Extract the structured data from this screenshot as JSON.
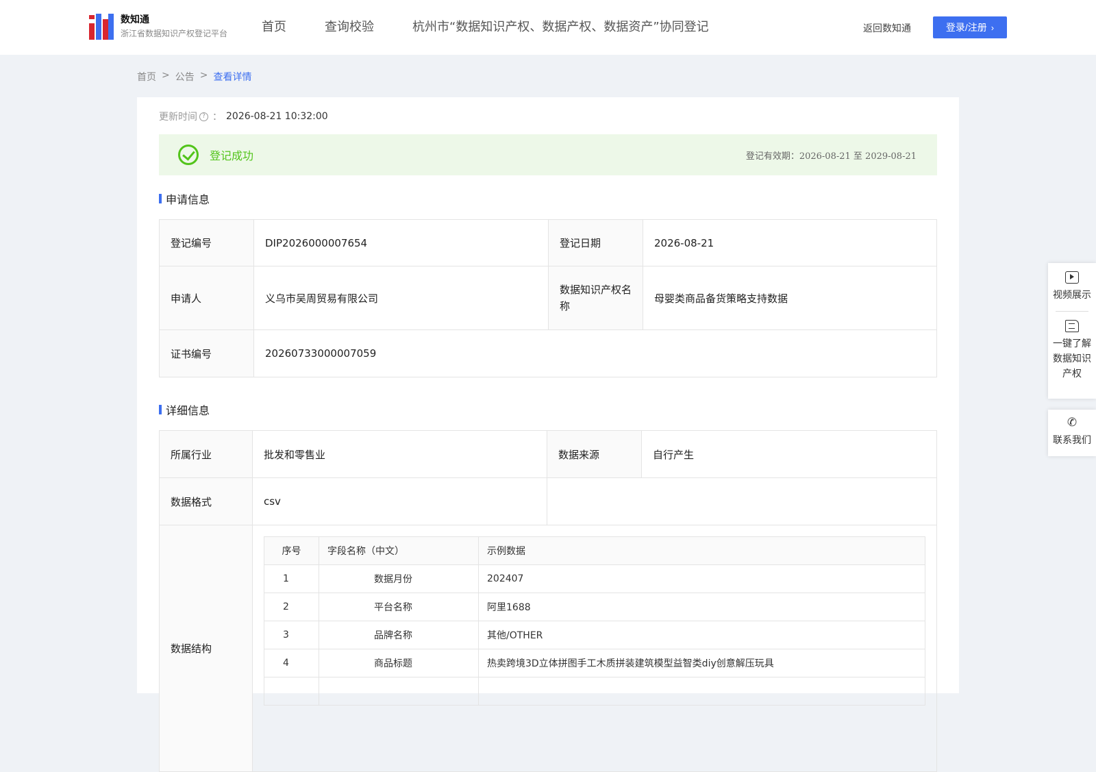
{
  "header": {
    "logo_title": "数知通",
    "logo_subtitle": "浙江省数据知识产权登记平台",
    "nav": [
      "首页",
      "查询校验",
      "杭州市“数据知识产权、数据产权、数据资产”协同登记"
    ],
    "back_link": "返回数知通",
    "login_label": "登录/注册",
    "accent_color": "#3d6ff0"
  },
  "breadcrumb": [
    "首页",
    ">",
    "公告",
    ">",
    "查看详情"
  ],
  "update": {
    "label": "更新时间",
    "colon": "：",
    "value": "2026-08-21 10:32:00"
  },
  "status": {
    "text": "登记成功",
    "validity": "登记有效期：2026-08-21 至 2029-08-21",
    "color": "#52c41a"
  },
  "application": {
    "title": "申请信息",
    "reg_no_label": "登记编号",
    "reg_no": "DIP2026000007654",
    "reg_date_label": "登记日期",
    "reg_date": "2026-08-21",
    "applicant_label": "申请人",
    "applicant": "义乌市吴周贸易有限公司",
    "ip_name_label": "数据知识产权名称",
    "ip_name": "母婴类商品备货策略支持数据",
    "cert_no_label": "证书编号",
    "cert_no": "20260733000007059"
  },
  "detail": {
    "title": "详细信息",
    "industry_label": "所属行业",
    "industry": "批发和零售业",
    "source_label": "数据来源",
    "source": "自行产生",
    "format_label": "数据格式",
    "format": "csv",
    "structure_label": "数据结构",
    "fields_header": {
      "no": "序号",
      "name": "字段名称（中文）",
      "example": "示例数据"
    },
    "fields": [
      {
        "no": "1",
        "name": "数据月份",
        "example": "202407"
      },
      {
        "no": "2",
        "name": "平台名称",
        "example": "阿里1688"
      },
      {
        "no": "3",
        "name": "品牌名称",
        "example": "其他/OTHER"
      },
      {
        "no": "4",
        "name": "商品标题",
        "example": "热卖跨境3D立体拼图手工木质拼装建筑模型益智类diy创意解压玩具"
      }
    ]
  },
  "float_panel": {
    "video": "视频展示",
    "learn": "一键了解数据知识产权",
    "contact": "联系我们"
  }
}
